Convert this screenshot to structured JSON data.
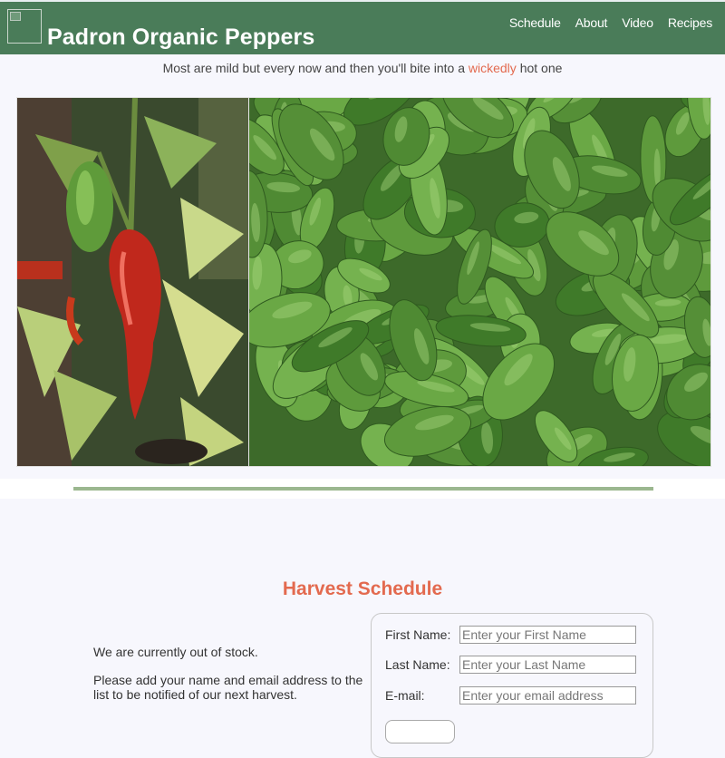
{
  "header": {
    "site_title": "Padron Organic Peppers",
    "logo_icon": "broken-image-icon",
    "nav": [
      {
        "label": "Schedule"
      },
      {
        "label": "About"
      },
      {
        "label": "Video"
      },
      {
        "label": "Recipes"
      }
    ]
  },
  "tagline": {
    "before": "Most are mild but every now and then you'll bite into a",
    "highlight": "wickedly",
    "after": "hot one"
  },
  "hero": {
    "left_photo_icon": "red-pepper-plant-photo",
    "right_photo_icon": "green-padron-peppers-photo"
  },
  "harvest": {
    "title": "Harvest Schedule",
    "status": "We are currently out of stock.",
    "instructions": "Please add your name and email address to the list to be notified of our next harvest."
  },
  "signup_form": {
    "first_name_label": "First Name:",
    "first_name_placeholder": "Enter your First Name",
    "last_name_label": "Last Name:",
    "last_name_placeholder": "Enter your Last Name",
    "email_label": "E-mail:",
    "email_placeholder": "Enter your email address"
  },
  "colors": {
    "header_green": "#4a7c59",
    "accent_coral": "#e36a4f",
    "divider_green": "#9bb78f",
    "page_background": "#f7f7fd"
  }
}
